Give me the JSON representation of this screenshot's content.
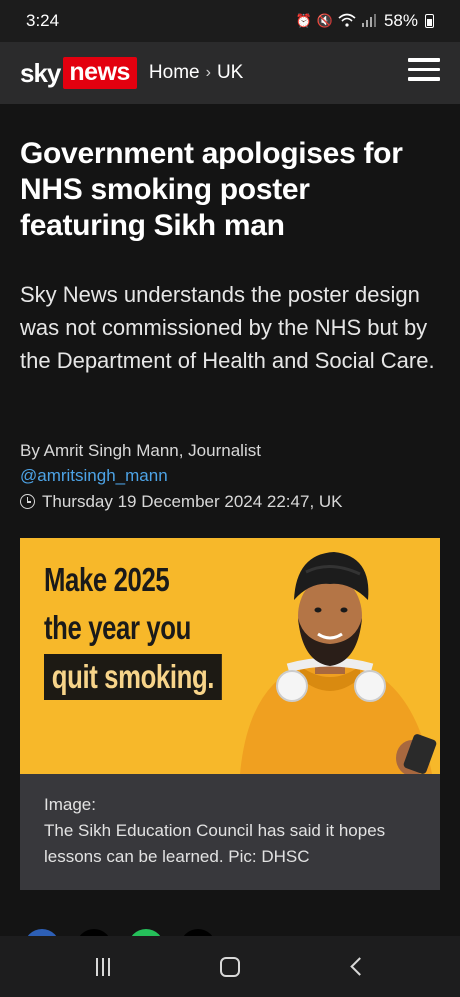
{
  "status_bar": {
    "time": "3:24",
    "battery": "58%",
    "icons": [
      "alarm-icon",
      "mute-icon",
      "wifi-icon",
      "signal-icon",
      "battery-icon"
    ]
  },
  "header": {
    "logo_sky": "sky",
    "logo_news": "news",
    "breadcrumb": [
      "Home",
      "UK"
    ],
    "breadcrumb_separator": "›",
    "accent_color": "#e3000f"
  },
  "article": {
    "headline": "Government apologises for NHS smoking poster featuring Sikh man",
    "standfirst": "Sky News understands the poster design was not commissioned by the NHS but by the Department of Health and Social Care.",
    "byline": "By Amrit Singh Mann, Journalist",
    "handle": "@amritsingh_mann",
    "timestamp": "Thursday 19 December 2024 22:47, UK"
  },
  "image": {
    "poster_lines": [
      "Make 2025",
      "the year you",
      "quit smoking."
    ],
    "caption_label": "Image:",
    "caption_text": "The Sikh Education Council has said it hopes lessons can be learned. Pic: DHSC",
    "background_color": "#f7b82a"
  },
  "nav_bar": {
    "buttons": [
      "recent-apps",
      "home",
      "back"
    ]
  }
}
